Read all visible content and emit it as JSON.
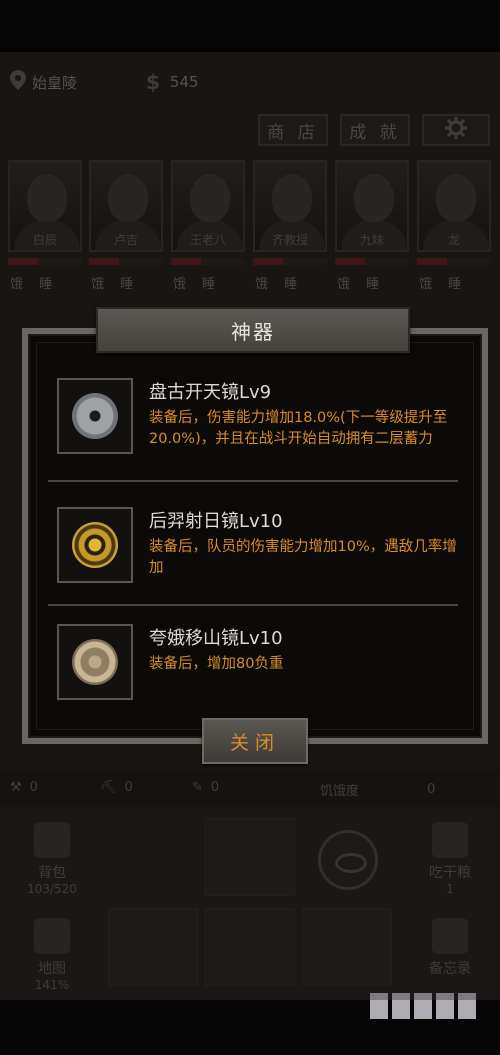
{
  "header": {
    "location": "始皇陵",
    "money": "545",
    "shop_label": "商 店",
    "achievements_label": "成 就"
  },
  "team": [
    {
      "name": "白辰",
      "status": "饿 睡"
    },
    {
      "name": "卢吉",
      "status": "饿 睡"
    },
    {
      "name": "王老八",
      "status": "饿 睡"
    },
    {
      "name": "齐教授",
      "status": "饿 睡"
    },
    {
      "name": "九妹",
      "status": "饿 睡"
    },
    {
      "name": "龙",
      "status": "饿 睡"
    }
  ],
  "resources": {
    "r1": "0",
    "r2": "0",
    "r3": "0",
    "hunger_label": "饥饿度",
    "hunger_value": "0"
  },
  "bottom": {
    "bag_label": "背包",
    "bag_value": "103/520",
    "map_label": "地图",
    "map_value": "141%",
    "eat_label": "吃干粮",
    "eat_value": "1",
    "memo_label": "备忘录"
  },
  "modal": {
    "title": "神器",
    "items": [
      {
        "name": "盘古开天镜Lv9",
        "desc": "装备后，伤害能力增加18.0%(下一等级提升至20.0%)，并且在战斗开始自动拥有二层蓄力",
        "icon": "silver-mirror-icon"
      },
      {
        "name": "后羿射日镜Lv10",
        "desc": "装备后，队员的伤害能力增加10%，遇敌几率增加",
        "icon": "golden-sun-mirror-icon"
      },
      {
        "name": "夸娥移山镜Lv10",
        "desc": "装备后，增加80负重",
        "icon": "bronze-mirror-icon"
      }
    ],
    "close_label": "关闭"
  },
  "colors": {
    "accent": "#d98d2a",
    "frame": "#6b6660",
    "panel_bg": "#0b0a09"
  }
}
